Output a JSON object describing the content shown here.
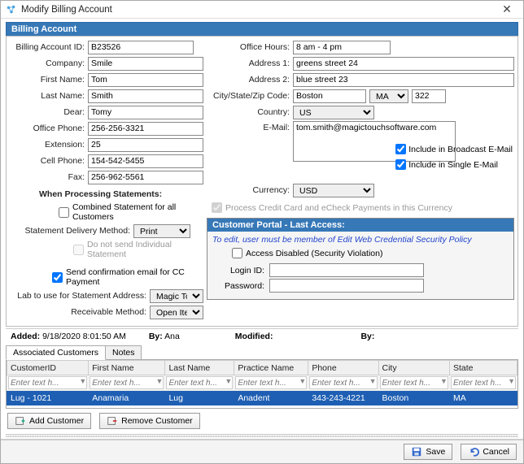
{
  "window": {
    "title": "Modify Billing Account"
  },
  "section": {
    "title": "Billing Account"
  },
  "left": {
    "acct_id_lbl": "Billing Account ID:",
    "acct_id": "B23526",
    "company_lbl": "Company:",
    "company": "Smile",
    "first_lbl": "First Name:",
    "first": "Tom",
    "last_lbl": "Last Name:",
    "last": "Smith",
    "dear_lbl": "Dear:",
    "dear": "Tomy",
    "ophone_lbl": "Office Phone:",
    "ophone": "256-256-3321",
    "ext_lbl": "Extension:",
    "ext": "25",
    "cphone_lbl": "Cell Phone:",
    "cphone": "154-542-5455",
    "fax_lbl": "Fax:",
    "fax": "256-962-5561",
    "when_proc": "When Processing Statements:",
    "combined_lbl": "Combined Statement for all Customers",
    "sdm_lbl": "Statement Delivery Method:",
    "sdm_val": "Print",
    "noindiv_lbl": "Do not send Individual Statement",
    "ccconf_lbl": "Send confirmation email for CC Payment",
    "labaddr_lbl": "Lab to use for Statement Address:",
    "labaddr_val": "Magic Touch",
    "recv_lbl": "Receivable Method:",
    "recv_val": "Open Item"
  },
  "right": {
    "hours_lbl": "Office Hours:",
    "hours": "8 am - 4 pm",
    "addr1_lbl": "Address 1:",
    "addr1": "greens street 24",
    "addr2_lbl": "Address 2:",
    "addr2": "blue street 23",
    "csz_lbl": "City/State/Zip Code:",
    "city": "Boston",
    "state": "MA",
    "zip": "322",
    "country_lbl": "Country:",
    "country": "US",
    "email_lbl": "E-Mail:",
    "email": "tom.smith@magictouchsoftware.com",
    "broadcast_lbl": "Include in Broadcast E-Mail",
    "single_lbl": "Include in Single E-Mail",
    "currency_lbl": "Currency:",
    "currency": "USD",
    "proccc_lbl": "Process Credit Card and eCheck Payments in this Currency"
  },
  "portal": {
    "title": "Customer Portal - Last Access:",
    "note": "To edit, user must be member of Edit Web Credential Security Policy",
    "accdis_lbl": "Access Disabled (Security Violation)",
    "login_lbl": "Login ID:",
    "login": "",
    "pwd_lbl": "Password:",
    "pwd": ""
  },
  "meta": {
    "added_lbl": "Added:",
    "added": "9/18/2020 8:01:50 AM",
    "by1_lbl": "By:",
    "by1": "Ana",
    "mod_lbl": "Modified:",
    "mod": "",
    "by2_lbl": "By:",
    "by2": ""
  },
  "tabs": {
    "tab1": "Associated Customers",
    "tab2": "Notes"
  },
  "grid": {
    "h1": "CustomerID",
    "h2": "First Name",
    "h3": "Last Name",
    "h4": "Practice Name",
    "h5": "Phone",
    "h6": "City",
    "h7": "State",
    "ph": "Enter text h...",
    "r1": {
      "c1": "Lug - 1021",
      "c2": "Anamaria",
      "c3": "Lug",
      "c4": "Anadent",
      "c5": "343-243-4221",
      "c6": "Boston",
      "c7": "MA"
    }
  },
  "buttons": {
    "add_cust": "Add Customer",
    "rem_cust": "Remove Customer",
    "save": "Save",
    "cancel": "Cancel"
  }
}
